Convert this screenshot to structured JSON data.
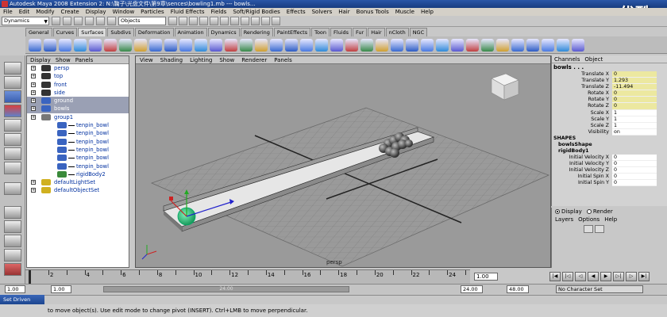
{
  "window": {
    "title": "Autodesk Maya 2008 Extension 2: N:\\鞠子\\光盘文件\\第9章\\sences\\bowling1.mb  ---  bowls...",
    "watermark": "优酷"
  },
  "menubar": [
    "File",
    "Edit",
    "Modify",
    "Create",
    "Display",
    "Window",
    "Particles",
    "Fluid Effects",
    "Fields",
    "Soft/Rigid Bodies",
    "Effects",
    "Solvers",
    "Hair",
    "Bonus Tools",
    "Muscle",
    "Help"
  ],
  "statusline": {
    "mode_value": "Dynamics",
    "selection_field": "Objects"
  },
  "shelf_tabs": [
    "General",
    "Curves",
    "Surfaces",
    "Subdivs",
    "Deformation",
    "Animation",
    "Dynamics",
    "Rendering",
    "PaintEffects",
    "Toon",
    "Fluids",
    "Fur",
    "Hair",
    "nCloth",
    "NGC"
  ],
  "shelf_active": "Surfaces",
  "outliner": {
    "menu": [
      "Display",
      "Show",
      "Panels"
    ],
    "items": [
      {
        "label": "persp",
        "icon": "camera-icon",
        "selected": false,
        "indent": 0
      },
      {
        "label": "top",
        "icon": "camera-icon",
        "selected": false,
        "indent": 0
      },
      {
        "label": "front",
        "icon": "camera-icon",
        "selected": false,
        "indent": 0
      },
      {
        "label": "side",
        "icon": "camera-icon",
        "selected": false,
        "indent": 0
      },
      {
        "label": "ground",
        "icon": "mesh-icon",
        "selected": true,
        "indent": 0
      },
      {
        "label": "bowls",
        "icon": "mesh-icon",
        "selected": true,
        "indent": 0
      },
      {
        "label": "group1",
        "icon": "group-icon",
        "selected": false,
        "indent": 0
      },
      {
        "label": "tenpin_bowl",
        "icon": "transform-icon",
        "selected": false,
        "indent": 1
      },
      {
        "label": "tenpin_bowl",
        "icon": "transform-icon",
        "selected": false,
        "indent": 1
      },
      {
        "label": "tenpin_bowl",
        "icon": "transform-icon",
        "selected": false,
        "indent": 1
      },
      {
        "label": "tenpin_bowl",
        "icon": "transform-icon",
        "selected": false,
        "indent": 1
      },
      {
        "label": "tenpin_bowl",
        "icon": "transform-icon",
        "selected": false,
        "indent": 1
      },
      {
        "label": "tenpin_bowl",
        "icon": "transform-icon",
        "selected": false,
        "indent": 1
      },
      {
        "label": "rigidBody2",
        "icon": "rigid-icon",
        "selected": false,
        "indent": 1
      },
      {
        "label": "defaultLightSet",
        "icon": "set-icon",
        "selected": false,
        "indent": 0
      },
      {
        "label": "defaultObjectSet",
        "icon": "set-icon",
        "selected": false,
        "indent": 0
      }
    ]
  },
  "viewport": {
    "menu": [
      "View",
      "Shading",
      "Lighting",
      "Show",
      "Renderer",
      "Panels"
    ],
    "camera_label": "persp"
  },
  "channelbox": {
    "menu": [
      "Channels",
      "Object"
    ],
    "object": "bowls . . .",
    "attributes": [
      {
        "label": "Translate X",
        "value": "0",
        "keyed": true
      },
      {
        "label": "Translate Y",
        "value": "1.293",
        "keyed": true
      },
      {
        "label": "Translate Z",
        "value": "-11.494",
        "keyed": true
      },
      {
        "label": "Rotate X",
        "value": "0",
        "keyed": true
      },
      {
        "label": "Rotate Y",
        "value": "0",
        "keyed": true
      },
      {
        "label": "Rotate Z",
        "value": "0",
        "keyed": true
      },
      {
        "label": "Scale X",
        "value": "1",
        "keyed": false
      },
      {
        "label": "Scale Y",
        "value": "1",
        "keyed": false
      },
      {
        "label": "Scale Z",
        "value": "1",
        "keyed": false
      },
      {
        "label": "Visibility",
        "value": "on",
        "keyed": false
      }
    ],
    "shapes_header": "SHAPES",
    "shape_name": "bowlsShape",
    "rigid_name": "rigidBody1",
    "rigid_attributes": [
      {
        "label": "Initial Velocity X",
        "value": "0"
      },
      {
        "label": "Initial Velocity Y",
        "value": "0"
      },
      {
        "label": "Initial Velocity Z",
        "value": "0"
      },
      {
        "label": "Initial Spin X",
        "value": "0"
      },
      {
        "label": "Initial Spin Y",
        "value": "0"
      }
    ]
  },
  "layers": {
    "display_label": "Display",
    "render_label": "Render",
    "menu": [
      "Layers",
      "Options",
      "Help"
    ]
  },
  "timeline": {
    "ticks": [
      "2",
      "4",
      "6",
      "8",
      "10",
      "12",
      "14",
      "16",
      "18",
      "20",
      "22",
      "24"
    ],
    "current_frame": "1.00"
  },
  "range": {
    "start_a": "1.00",
    "start_b": "1.00",
    "end_a": "24.00",
    "end_b": "48.00",
    "slider_label": "24.00",
    "char_set": "No Character Set"
  },
  "taskbar": {
    "label": "Set Driven"
  },
  "help": {
    "text": "to move object(s). Use edit mode to change pivot (INSERT).  Ctrl+LMB to move perpendicular."
  }
}
